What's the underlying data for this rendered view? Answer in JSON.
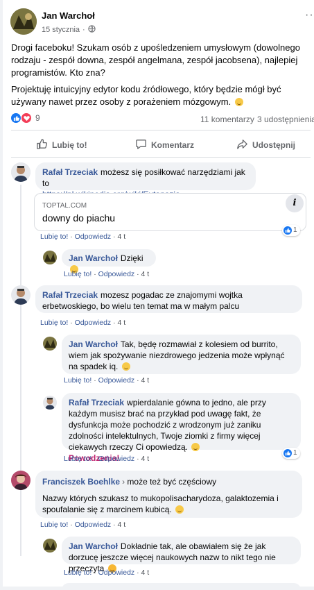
{
  "post": {
    "author": "Jan Warchoł",
    "date": "15 stycznia",
    "paragraph1": "Drogi faceboku! Szukam osób z upośledzeniem umysłowym (dowolnego rodzaju - zespół downa, zespół angelmana, zespół jacobsena), najlepiej programistów. Kto zna?",
    "paragraph2": "Projektuję intuicyjny edytor kodu źródłowego, który będzie mógł być używany nawet przez osoby z porażeniem mózgowym.",
    "reactions_count": "9",
    "comments_count": "11 komentarzy",
    "shares_count": "3 udostępnienia"
  },
  "buttons": {
    "like": "Lubię to!",
    "comment": "Komentarz",
    "share": "Udostępnij"
  },
  "labels": {
    "like": "Lubię to!",
    "reply": "Odpowiedz",
    "age": "4 t"
  },
  "comments": [
    {
      "author": "Rafał Trzeciak",
      "text": "możesz się posiłkować narzędziami jak to",
      "link": "https://pl.wikipedia.org/wiki/Eutanazja",
      "preview": {
        "domain": "TOPTAL.COM",
        "title": "downy do piachu",
        "likes": "1"
      }
    },
    {
      "author": "Jan Warchoł",
      "text": "Dzięki"
    },
    {
      "author": "Rafał Trzeciak",
      "text": "mozesz pogadac ze znajomymi wojtka erbetwoskiego, bo wielu ten temat ma w małym palcu"
    },
    {
      "author": "Jan Warchoł",
      "text": "Tak, będę rozmawiał z kolesiem od burrito, wiem jak spożywanie niezdrowego jedzenia może wpłynąć na spadek iq."
    },
    {
      "author": "Rafał Trzeciak",
      "text": "wpierdalanie gówna to jedno, ale przy każdym musisz brać na przykład pod uwagę fakt, że dysfunkcja może pochodzić z wrodzonym już zaniku zdolności intelektulnych, Twoje ziomki z firmy więcej ciekawych rzeczy Ci opowiedzą.",
      "highlight": "Powodzenia!",
      "likes": "1"
    },
    {
      "author": "Franciszek Boehlke",
      "target": "może też być częściowy",
      "text": "Nazwy których szukasz to mukopolisacharydoza, galaktozemia i spoufalanie się z marcinem kubicą."
    },
    {
      "author": "Jan Warchoł",
      "text": "Dokładnie tak, ale obawiałem się że jak dorzucę jeszcze więcej naukowych nazw to nikt tego nie przeczyta"
    }
  ],
  "colors": {
    "link": "#385898",
    "like_blue": "#1877f2",
    "heart": "#f33e58",
    "highlight_pink": "#c0226f"
  }
}
